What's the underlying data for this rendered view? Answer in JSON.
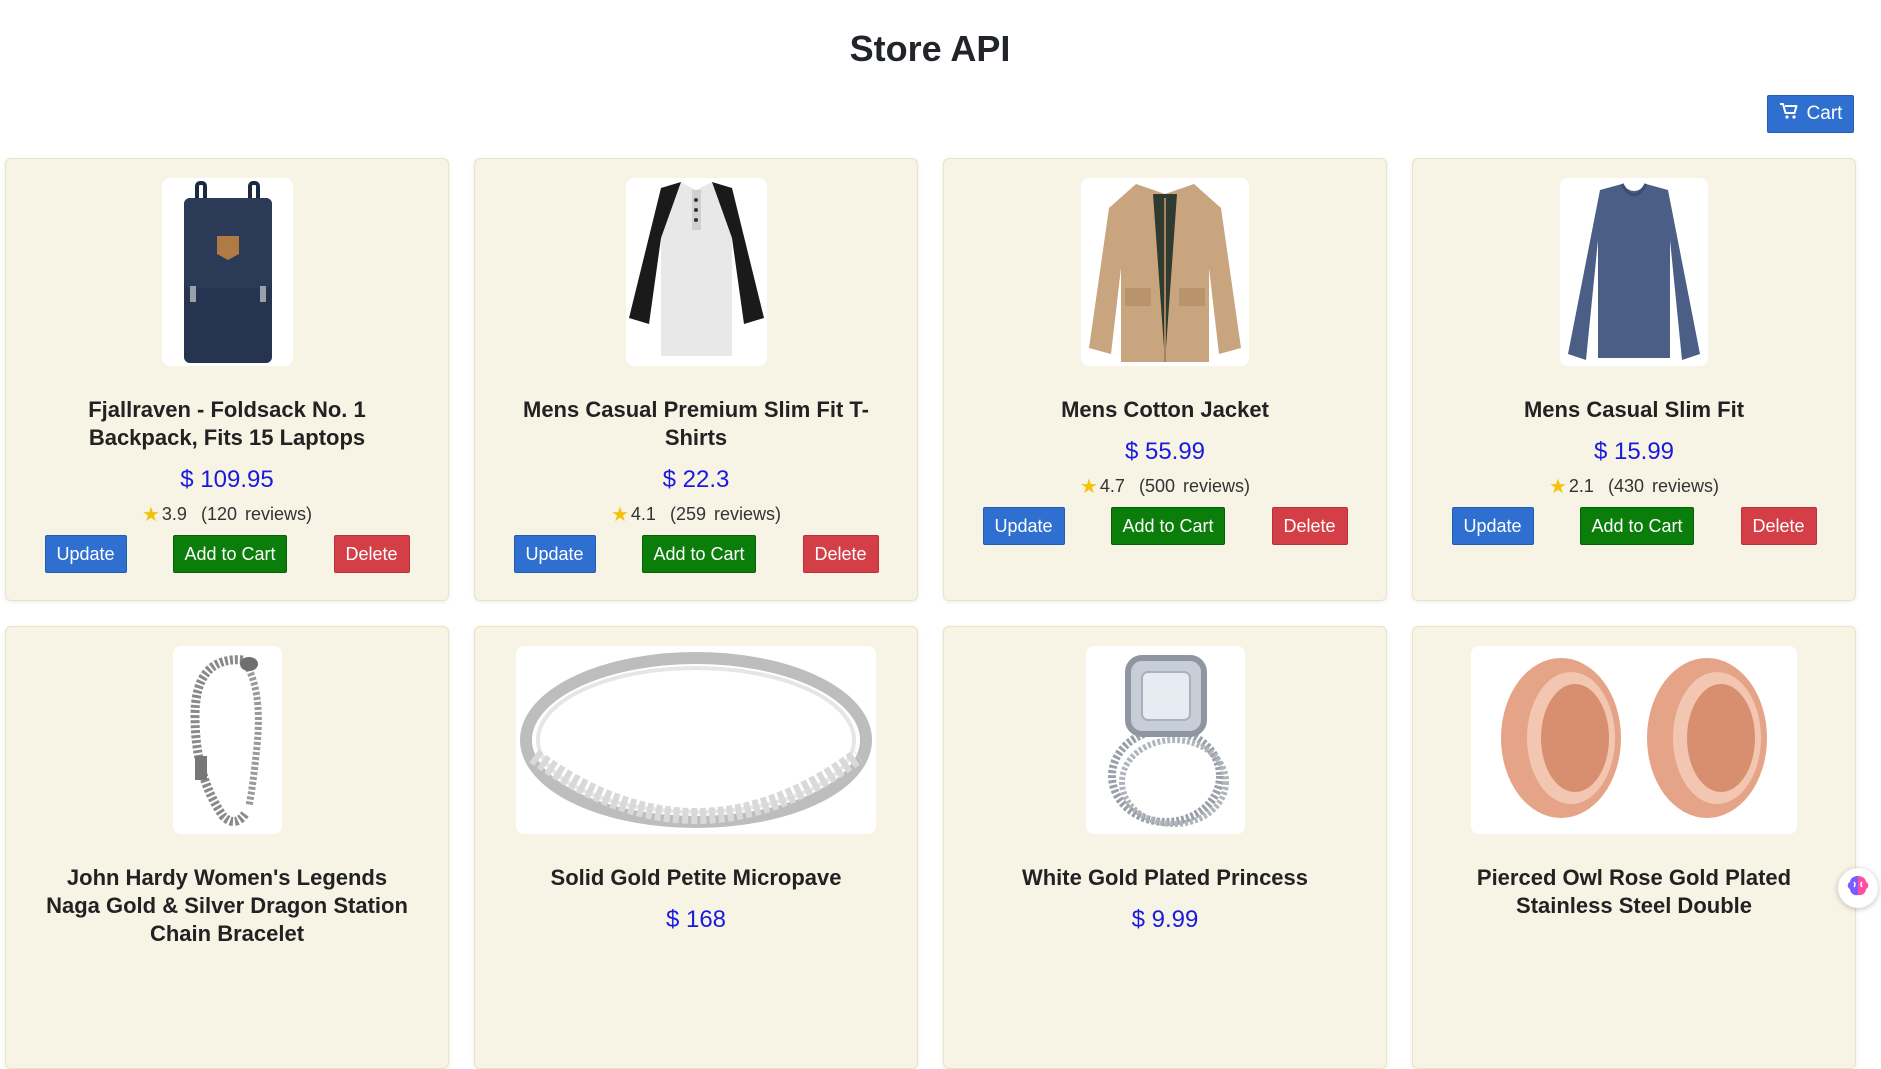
{
  "header": {
    "title": "Store API"
  },
  "cart": {
    "label": "Cart"
  },
  "colors": {
    "update": "#2e6fd0",
    "add_to_cart": "#0a7d0a",
    "delete": "#d43f47",
    "price": "#1a1adf",
    "card_bg": "#f7f4e6",
    "star": "#f4c20d"
  },
  "buttons": {
    "update": "Update",
    "add_to_cart": "Add to Cart",
    "delete": "Delete"
  },
  "products": [
    {
      "name": "Fjallraven - Foldsack No. 1 Backpack, Fits 15 Laptops",
      "price": "$ 109.95",
      "rating": "3.9",
      "reviews": "(120 reviews)",
      "icon": "backpack-image"
    },
    {
      "name": "Mens Casual Premium Slim Fit T-Shirts",
      "price": "$ 22.3",
      "rating": "4.1",
      "reviews": "(259 reviews)",
      "icon": "tshirt-image"
    },
    {
      "name": "Mens Cotton Jacket",
      "price": "$ 55.99",
      "rating": "4.7",
      "reviews": "(500 reviews)",
      "icon": "jacket-image"
    },
    {
      "name": "Mens Casual Slim Fit",
      "price": "$ 15.99",
      "rating": "2.1",
      "reviews": "(430 reviews)",
      "icon": "longsleeve-image"
    },
    {
      "name": "John Hardy Women's Legends Naga Gold & Silver Dragon Station Chain Bracelet",
      "price": "",
      "rating": "",
      "reviews": "",
      "icon": "bracelet-image"
    },
    {
      "name": "Solid Gold Petite Micropave",
      "price": "$ 168",
      "rating": "",
      "reviews": "",
      "icon": "ring-image"
    },
    {
      "name": "White Gold Plated Princess",
      "price": "$ 9.99",
      "rating": "",
      "reviews": "",
      "icon": "princess-ring-image"
    },
    {
      "name": "Pierced Owl Rose Gold Plated Stainless Steel Double",
      "price": "",
      "rating": "",
      "reviews": "",
      "icon": "plugs-image"
    }
  ]
}
